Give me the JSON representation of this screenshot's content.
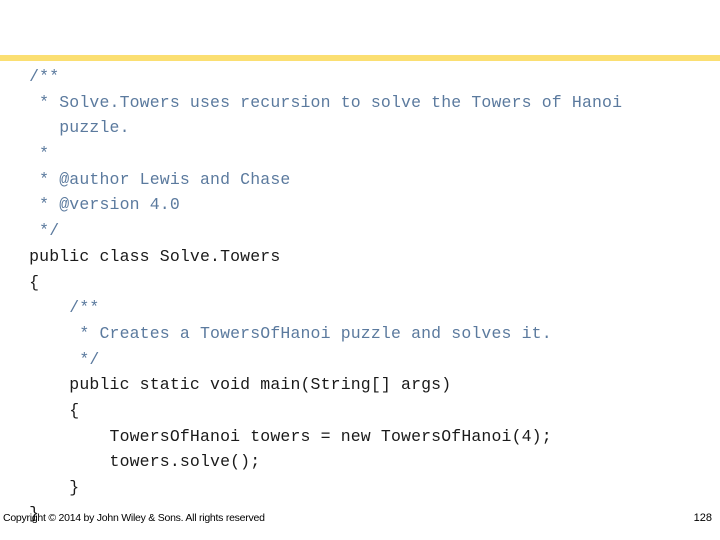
{
  "slide": {
    "accent_color": "#fbdf72",
    "background_color": "#ffffff",
    "comment_color": "#5b7a9e",
    "code_color": "#1a1a1a"
  },
  "code": {
    "language": "java",
    "lines": [
      {
        "text": "  /**",
        "kind": "comment"
      },
      {
        "text": "   * Solve.Towers uses recursion to solve the Towers of Hanoi",
        "kind": "comment"
      },
      {
        "text": "     puzzle.",
        "kind": "comment"
      },
      {
        "text": "   *",
        "kind": "comment"
      },
      {
        "text": "   * @author Lewis and Chase",
        "kind": "comment"
      },
      {
        "text": "   * @version 4.0",
        "kind": "comment"
      },
      {
        "text": "   */",
        "kind": "comment"
      },
      {
        "text": "  public class Solve.Towers",
        "kind": "code"
      },
      {
        "text": "  {",
        "kind": "code"
      },
      {
        "text": "      /**",
        "kind": "comment"
      },
      {
        "text": "       * Creates a TowersOfHanoi puzzle and solves it.",
        "kind": "comment"
      },
      {
        "text": "       */",
        "kind": "comment"
      },
      {
        "text": "      public static void main(String[] args)",
        "kind": "code"
      },
      {
        "text": "      {",
        "kind": "code"
      },
      {
        "text": "          TowersOfHanoi towers = new TowersOfHanoi(4);",
        "kind": "code"
      },
      {
        "text": "          towers.solve();",
        "kind": "code"
      },
      {
        "text": "      }",
        "kind": "code"
      },
      {
        "text": "  }",
        "kind": "code"
      }
    ]
  },
  "footer": {
    "copyright": "Copyright © 2014 by John Wiley & Sons.  All rights reserved",
    "page_number": "128"
  }
}
